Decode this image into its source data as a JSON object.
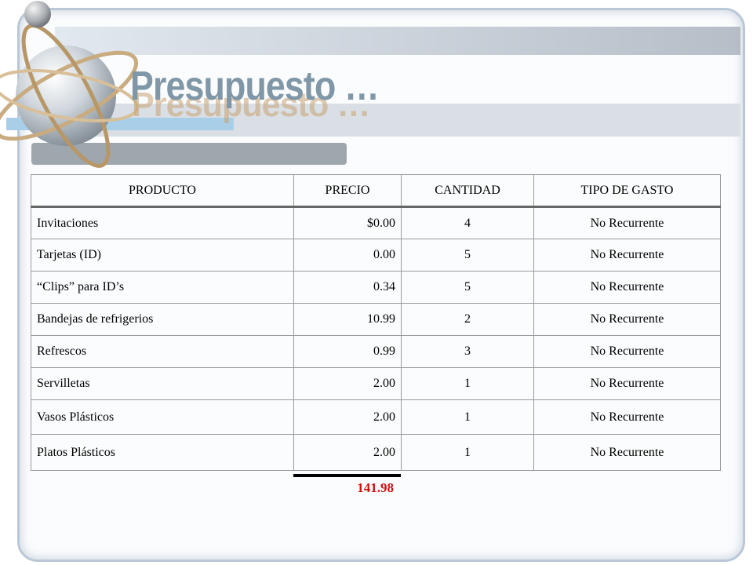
{
  "slide": {
    "title": "Presupuesto …",
    "colors": {
      "title": "#7f97a6",
      "total": "#d01010",
      "accent_bar": "#a9cfe8"
    }
  },
  "table": {
    "headers": [
      "PRODUCTO",
      "PRECIO",
      "CANTIDAD",
      "TIPO DE GASTO"
    ],
    "rows": [
      [
        "Invitaciones",
        "$0.00",
        "4",
        "No Recurrente"
      ],
      [
        "Tarjetas (ID)",
        "0.00",
        "5",
        "No Recurrente"
      ],
      [
        "“Clips” para ID’s",
        "0.34",
        "5",
        "No Recurrente"
      ],
      [
        "Bandejas de refrigerios",
        "10.99",
        "2",
        "No Recurrente"
      ],
      [
        "Refrescos",
        "0.99",
        "3",
        "No Recurrente"
      ],
      [
        "Servilletas",
        "2.00",
        "1",
        "No Recurrente"
      ],
      [
        "Vasos Plásticos",
        "2.00",
        "1",
        "No Recurrente"
      ],
      [
        "Platos Plásticos",
        "2.00",
        "1",
        "No Recurrente"
      ]
    ],
    "total": "141.98"
  },
  "icons": [
    "atom-orbit-graphic"
  ]
}
